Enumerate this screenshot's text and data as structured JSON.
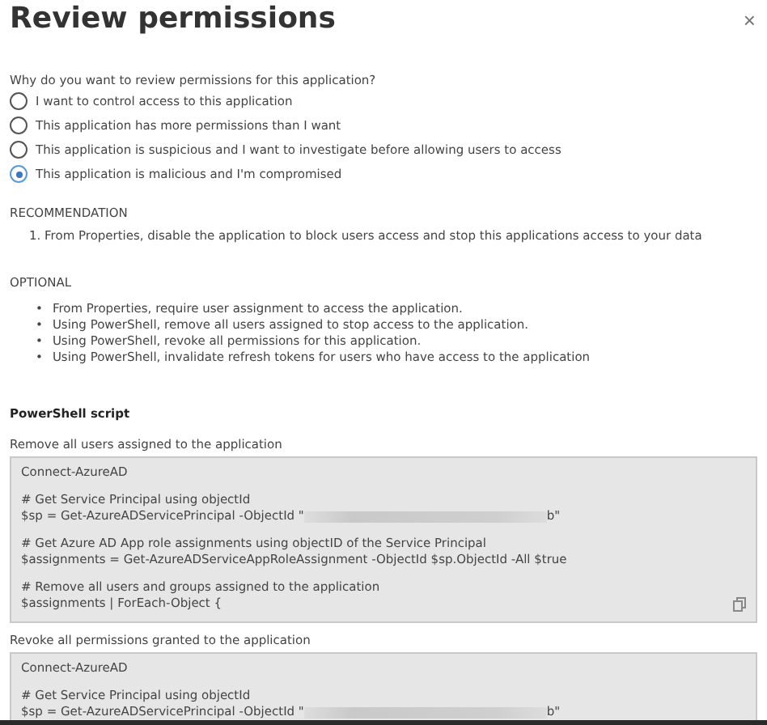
{
  "title": "Review permissions",
  "close": "×",
  "question": "Why do you want to review permissions for this application?",
  "options": [
    {
      "label": "I want to control access to this application",
      "selected": false
    },
    {
      "label": "This application has more permissions than I want",
      "selected": false
    },
    {
      "label": "This application is suspicious and I want to investigate before allowing users to access",
      "selected": false
    },
    {
      "label": "This application is malicious and I'm compromised",
      "selected": true
    }
  ],
  "recommendation": {
    "heading": "RECOMMENDATION",
    "items": [
      "1. From Properties, disable the application to block users access and stop this applications access to your data"
    ]
  },
  "optional": {
    "heading": "OPTIONAL",
    "items": [
      {
        "marker": "•",
        "text": "From Properties, require user assignment to access the application."
      },
      {
        "marker": "•",
        "text": "Using PowerShell, remove all users assigned to stop access to the application."
      },
      {
        "marker": "•",
        "text": "Using PowerShell, revoke all permissions for this application."
      },
      {
        "marker": "•",
        "text": "Using PowerShell, invalidate refresh tokens for users who have access to the application"
      }
    ]
  },
  "powershell_heading": "PowerShell script",
  "scripts": [
    {
      "label": "Remove all users assigned to the application",
      "copyable": true,
      "lines": [
        {
          "kind": "text",
          "text": "Connect-AzureAD"
        },
        {
          "kind": "blank"
        },
        {
          "kind": "text",
          "text": "# Get Service Principal using objectId"
        },
        {
          "kind": "redacted",
          "before": "$sp = Get-AzureADServicePrincipal -ObjectId \"",
          "after": "b\""
        },
        {
          "kind": "blank"
        },
        {
          "kind": "text",
          "text": "# Get Azure AD App role assignments using objectID of the Service Principal"
        },
        {
          "kind": "text",
          "text": "$assignments = Get-AzureADServiceAppRoleAssignment -ObjectId $sp.ObjectId -All $true"
        },
        {
          "kind": "blank"
        },
        {
          "kind": "text",
          "text": "# Remove all users and groups assigned to the application"
        },
        {
          "kind": "text",
          "text": "$assignments | ForEach-Object {"
        }
      ]
    },
    {
      "label": "Revoke all permissions granted to the application",
      "lines": [
        {
          "kind": "text",
          "text": "Connect-AzureAD"
        },
        {
          "kind": "blank"
        },
        {
          "kind": "text",
          "text": "# Get Service Principal using objectId"
        },
        {
          "kind": "redacted",
          "before": "$sp = Get-AzureADServicePrincipal -ObjectId \"",
          "after": "b\""
        }
      ]
    }
  ]
}
